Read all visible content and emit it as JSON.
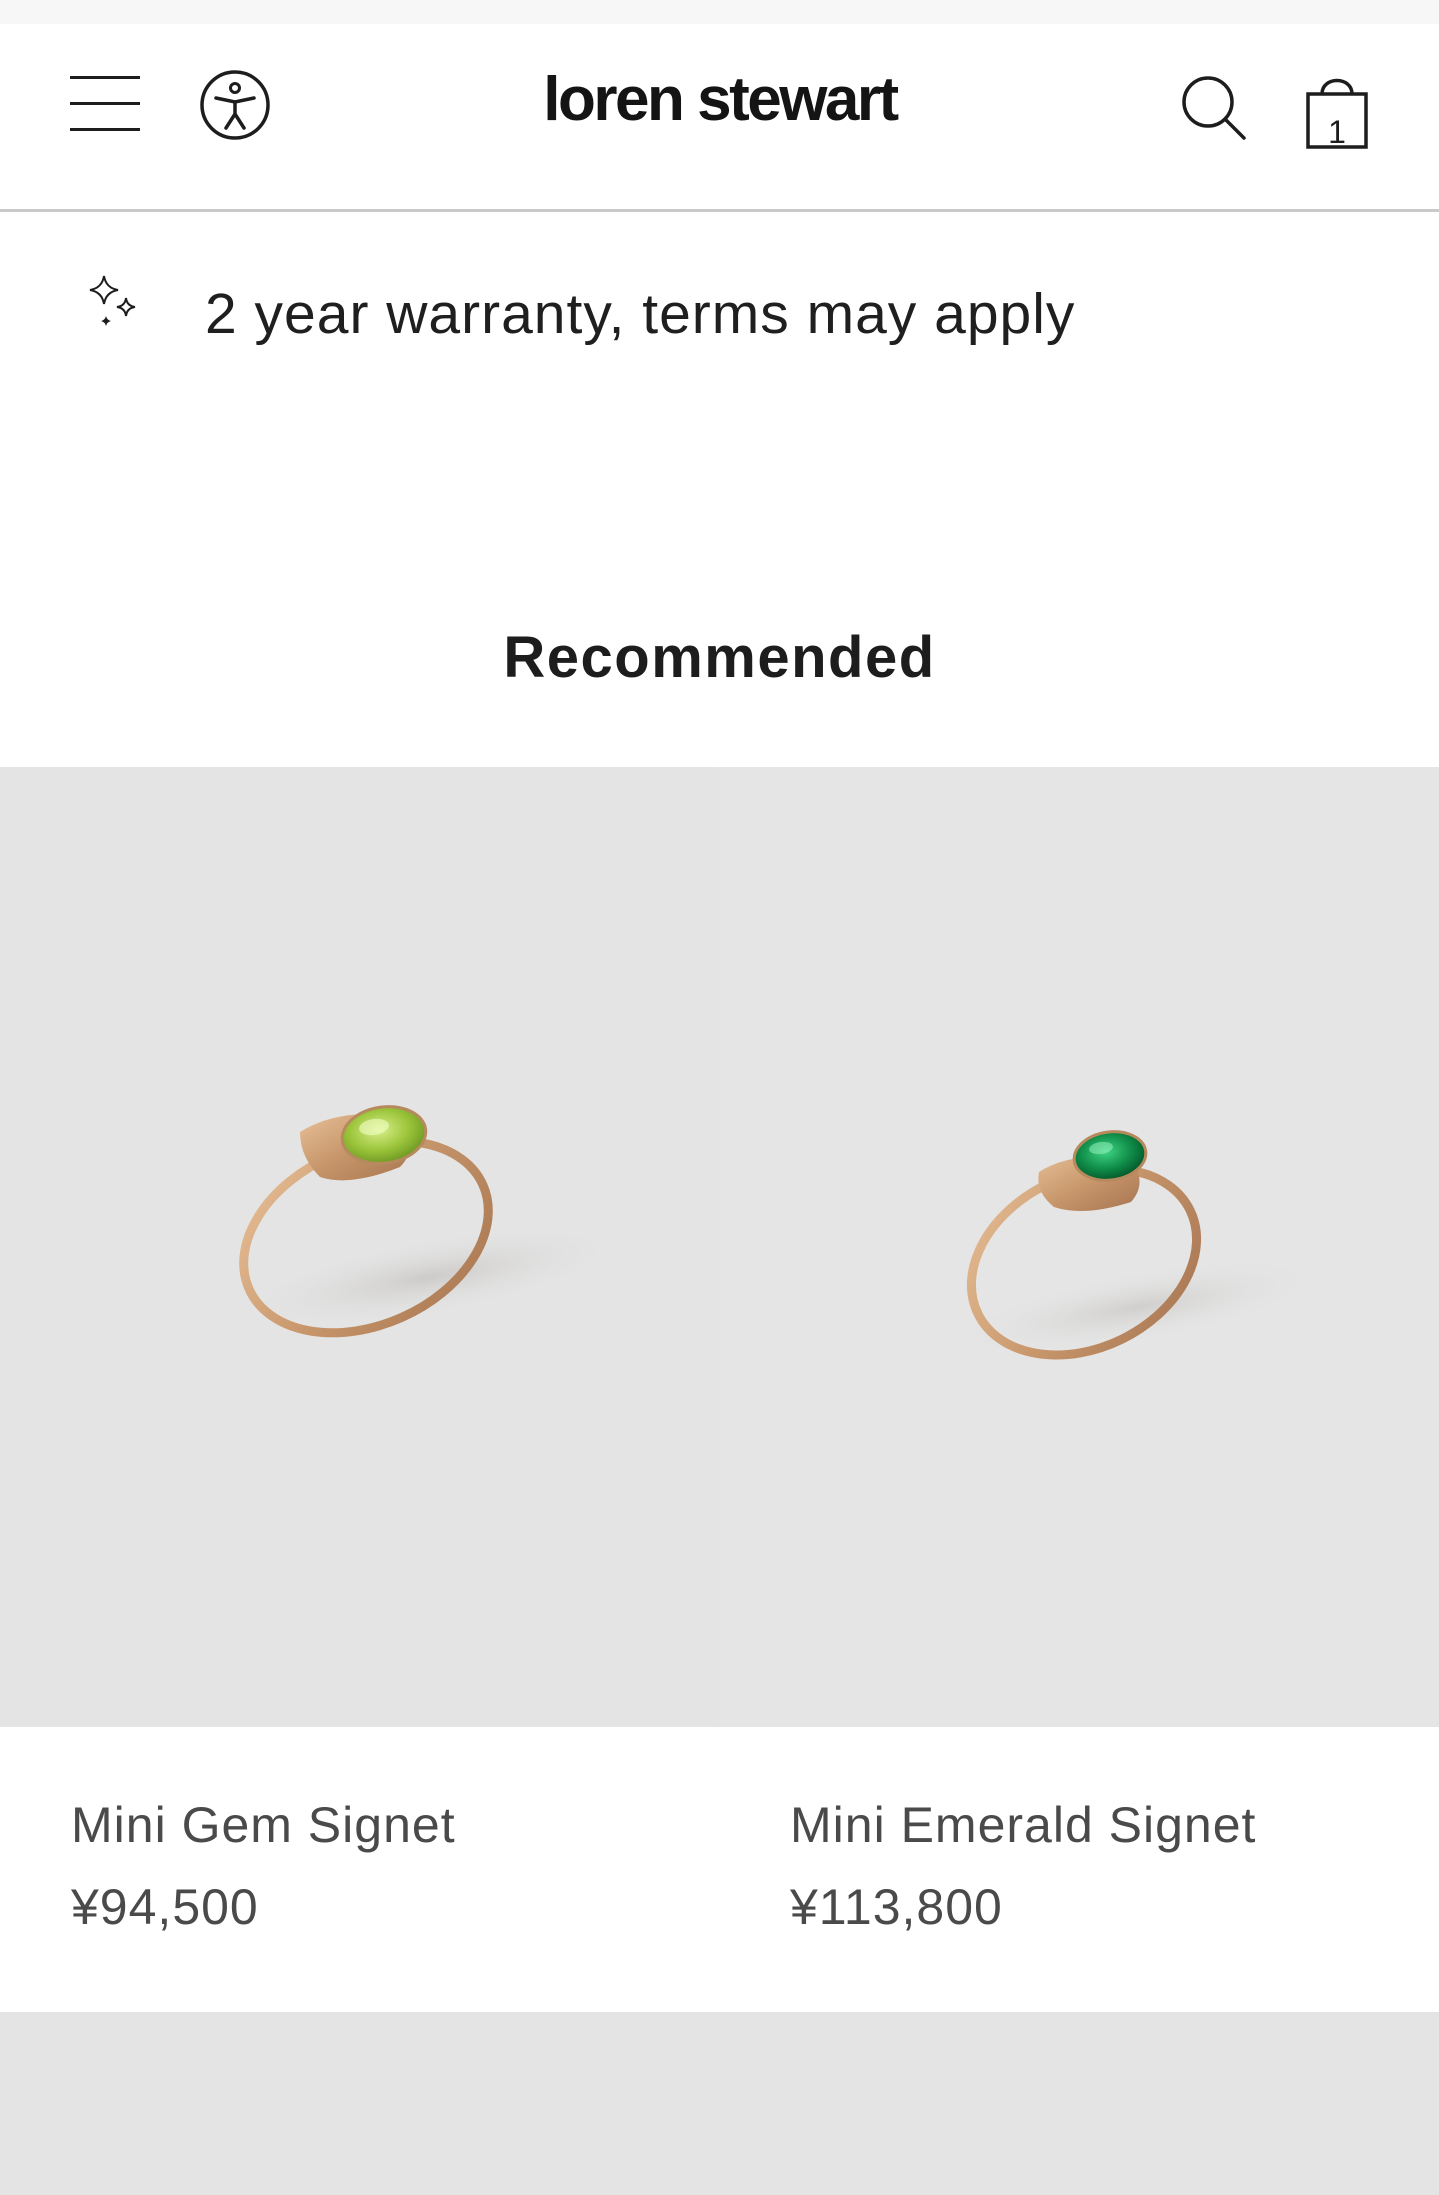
{
  "header": {
    "logo_text": "loren stewart",
    "menu_icon": "hamburger-menu-icon",
    "accessibility_icon": "accessibility-icon",
    "search_icon": "search-icon",
    "cart_icon": "shopping-bag-icon",
    "cart_count": "1"
  },
  "warranty": {
    "icon": "sparkle-icon",
    "text": "2 year warranty, terms may apply"
  },
  "recommended": {
    "title": "Recommended",
    "products": [
      {
        "name": "Mini Gem Signet",
        "price": "¥94,500",
        "stone_color": "#9bc43a",
        "image_icon": "gold-ring-peridot-image"
      },
      {
        "name": "Mini Emerald Signet",
        "price": "¥113,800",
        "stone_color": "#0f8c48",
        "image_icon": "gold-ring-emerald-image"
      }
    ]
  },
  "colors": {
    "background": "#ffffff",
    "image_bg": "#e4e4e4",
    "text": "#1d1d1d",
    "muted_text": "#4a4a4a",
    "divider": "#c9c9c9"
  }
}
